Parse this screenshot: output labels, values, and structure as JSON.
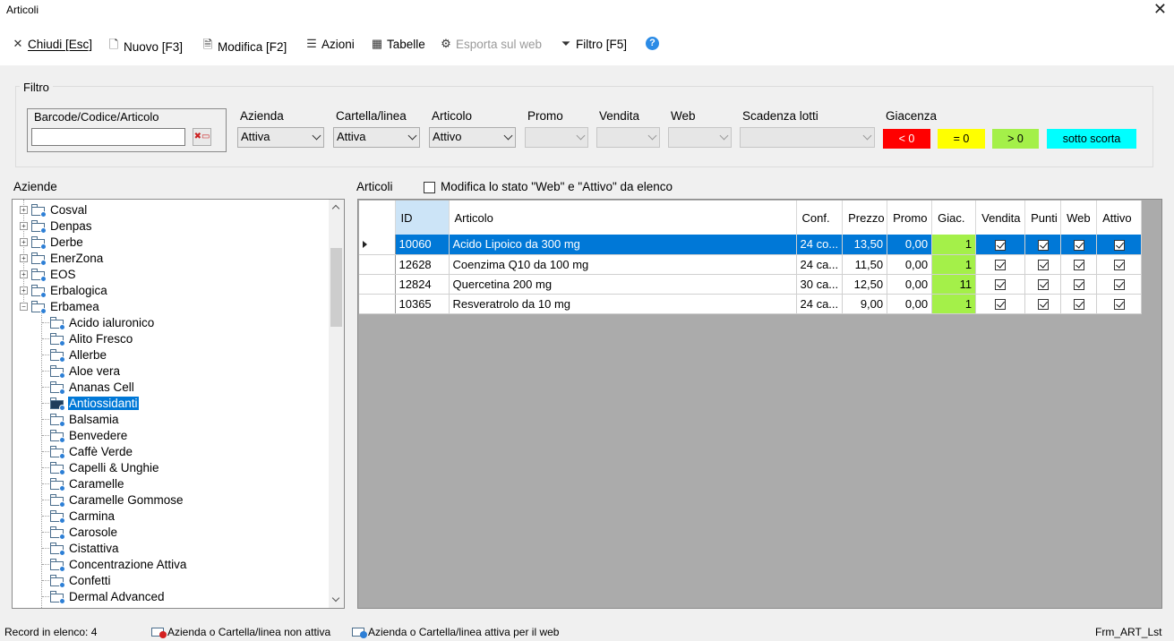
{
  "window": {
    "title": "Articoli",
    "close_glyph": "✕"
  },
  "toolbar": {
    "close": "Chiudi [Esc]",
    "new": "Nuovo [F3]",
    "edit": "Modifica [F2]",
    "actions": "Azioni",
    "tables": "Tabelle",
    "export_web": "Esporta sul web",
    "filter": "Filtro [F5]",
    "help_glyph": "?"
  },
  "filter": {
    "group_title": "Filtro",
    "barcode_label": "Barcode/Codice/Articolo",
    "barcode_value": "",
    "azienda_label": "Azienda",
    "azienda_value": "Attiva",
    "cartella_label": "Cartella/linea",
    "cartella_value": "Attiva",
    "articolo_label": "Articolo",
    "articolo_value": "Attivo",
    "promo_label": "Promo",
    "promo_value": "",
    "vendita_label": "Vendita",
    "vendita_value": "",
    "web_label": "Web",
    "web_value": "",
    "scadenza_label": "Scadenza lotti",
    "scadenza_value": "",
    "giacenza_label": "Giacenza",
    "giacenza": {
      "neg": "< 0",
      "zero": "= 0",
      "pos": "> 0",
      "sotto": "sotto scorta",
      "colors": {
        "neg": "#ff0000",
        "zero": "#ffff00",
        "pos": "#a4f049",
        "sotto": "#00ffff"
      }
    }
  },
  "tree": {
    "label": "Aziende",
    "top_items": [
      "Cosval",
      "Denpas",
      "Derbe",
      "EnerZona",
      "EOS",
      "Erbalogica",
      "Erbamea"
    ],
    "children": [
      "Acido ialuronico",
      "Alito Fresco",
      "Allerbe",
      "Aloe vera",
      "Ananas Cell",
      "Antiossidanti",
      "Balsamia",
      "Benvedere",
      "Caffè Verde",
      "Capelli & Unghie",
      "Caramelle",
      "Caramelle Gommose",
      "Carmina",
      "Carosole",
      "Cistattiva",
      "Concentrazione Attiva",
      "Confetti",
      "Dermal Advanced"
    ],
    "selected": "Antiossidanti"
  },
  "grid": {
    "label": "Articoli",
    "edit_state_label": "Modifica lo stato \"Web\" e \"Attivo\" da elenco",
    "columns": [
      "ID",
      "Articolo",
      "Conf.",
      "Prezzo",
      "Promo",
      "Giac.",
      "Vendita",
      "Punti",
      "Web",
      "Attivo"
    ],
    "rows": [
      {
        "id": "10060",
        "articolo": "Acido Lipoico da 300 mg",
        "conf": "24 co...",
        "prezzo": "13,50",
        "promo": "0,00",
        "giac": "1"
      },
      {
        "id": "12628",
        "articolo": "Coenzima Q10 da 100 mg",
        "conf": "24 ca...",
        "prezzo": "11,50",
        "promo": "0,00",
        "giac": "1"
      },
      {
        "id": "12824",
        "articolo": "Quercetina 200 mg",
        "conf": "30 ca...",
        "prezzo": "12,50",
        "promo": "0,00",
        "giac": "11"
      },
      {
        "id": "10365",
        "articolo": "Resveratrolo da 10 mg",
        "conf": "24 ca...",
        "prezzo": "9,00",
        "promo": "0,00",
        "giac": "1"
      }
    ]
  },
  "status": {
    "records": "Record in elenco: 4",
    "legend_inactive": "Azienda o Cartella/linea non attiva",
    "legend_web": "Azienda o Cartella/linea attiva per il web",
    "form_name": "Frm_ART_Lst"
  }
}
